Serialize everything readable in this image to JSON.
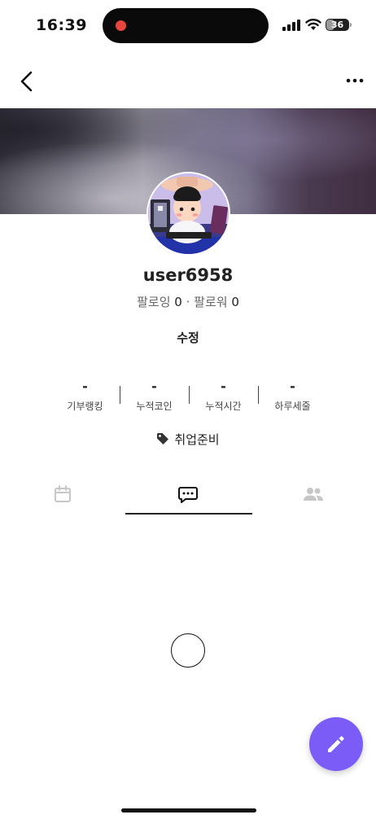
{
  "status_bar": {
    "time": "16:39",
    "battery": "36",
    "battery_level": 0.36
  },
  "nav": {
    "back_icon": "chevron-left-icon",
    "more_icon": "more-horizontal-icon"
  },
  "profile": {
    "username": "user6958",
    "following_label": "팔로잉",
    "following_count": "0",
    "separator": "·",
    "followers_label": "팔로워",
    "followers_count": "0",
    "edit_label": "수정"
  },
  "stats": [
    {
      "value": "-",
      "label": "기부랭킹"
    },
    {
      "value": "-",
      "label": "누적코인"
    },
    {
      "value": "-",
      "label": "누적시간"
    },
    {
      "value": "-",
      "label": "하루세줄"
    }
  ],
  "tag": {
    "icon": "tag-icon",
    "label": "취업준비"
  },
  "tabs": [
    {
      "icon": "calendar-icon",
      "active": false
    },
    {
      "icon": "chat-bubble-icon",
      "active": true
    },
    {
      "icon": "people-icon",
      "active": false
    }
  ],
  "fab": {
    "icon": "pencil-icon",
    "color": "#7b5cf6"
  },
  "colors": {
    "accent": "#7b5cf6",
    "text": "#222222",
    "muted": "#666666",
    "inactive_icon": "#c7c7c7"
  }
}
